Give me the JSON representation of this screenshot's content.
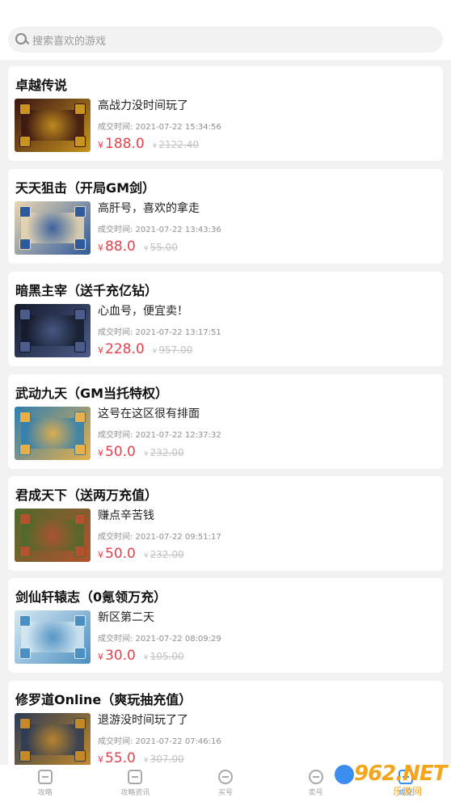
{
  "search": {
    "placeholder": "搜索喜欢的游戏"
  },
  "currency_symbol": "¥",
  "accent_color": "#e5414c",
  "items": [
    {
      "title": "卓越传说",
      "desc": "高战力没时间玩了",
      "time": "成交时间: 2021-07-22 15:34:56",
      "price": "188.0",
      "original": "2122.40",
      "thumb_colors": [
        "#3a1512",
        "#c8941f"
      ]
    },
    {
      "title": "天天狙击（开局GM剑）",
      "desc": "高肝号，喜欢的拿走",
      "time": "成交时间: 2021-07-22 13:43:36",
      "price": "88.0",
      "original": "55.00",
      "thumb_colors": [
        "#e9d7b2",
        "#2e5a9c"
      ]
    },
    {
      "title": "暗黑主宰（送千充亿钻）",
      "desc": "心血号，便宜卖！",
      "time": "成交时间: 2021-07-22 13:17:51",
      "price": "228.0",
      "original": "957.00",
      "thumb_colors": [
        "#141a2a",
        "#4b5c8a"
      ]
    },
    {
      "title": "武动九天（GM当托特权）",
      "desc": "这号在这区很有排面",
      "time": "成交时间: 2021-07-22 12:37:32",
      "price": "50.0",
      "original": "232.00",
      "thumb_colors": [
        "#2f7fb0",
        "#e8b04a"
      ]
    },
    {
      "title": "君成天下（送两万充值）",
      "desc": "赚点辛苦钱",
      "time": "成交时间: 2021-07-22 09:51:17",
      "price": "50.0",
      "original": "232.00",
      "thumb_colors": [
        "#4f6a2c",
        "#b3522e"
      ]
    },
    {
      "title": "剑仙轩辕志（0氪领万充）",
      "desc": "新区第二天",
      "time": "成交时间: 2021-07-22 08:09:29",
      "price": "30.0",
      "original": "105.00",
      "thumb_colors": [
        "#d6e9f2",
        "#4c8fc2"
      ]
    },
    {
      "title": "修罗道Online（爽玩抽充值）",
      "desc": "退游没时间玩了了",
      "time": "成交时间: 2021-07-22 07:46:16",
      "price": "55.0",
      "original": "307.00",
      "thumb_colors": [
        "#2b3a55",
        "#c48a2a"
      ]
    }
  ],
  "tabs": [
    {
      "label": "攻略",
      "icon": "book-icon",
      "active": false
    },
    {
      "label": "攻略资讯",
      "icon": "news-icon",
      "active": false
    },
    {
      "label": "买号",
      "icon": "buy-icon",
      "active": false
    },
    {
      "label": "卖号",
      "icon": "sell-icon",
      "active": false
    },
    {
      "label": "成交",
      "icon": "deal-icon",
      "active": true
    }
  ],
  "watermark": {
    "text": "962.NET",
    "sub": "乐游网"
  }
}
